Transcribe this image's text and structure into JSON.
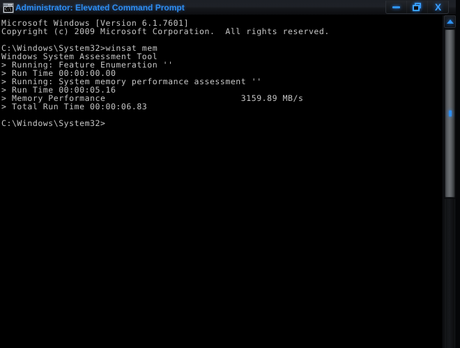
{
  "window": {
    "title": "Administrator: Elevated Command Prompt",
    "icon": "console-window-icon",
    "icon_text": "C:\\",
    "title_color": "#2f8ef0",
    "titlebar_background": "#15171b",
    "controls": [
      {
        "name": "minimize",
        "label": "Minimize",
        "glyph": "minimize-icon",
        "color": "#3094f2"
      },
      {
        "name": "restore",
        "label": "Restore Down",
        "glyph": "restore-icon",
        "color": "#3aa0ff"
      },
      {
        "name": "close",
        "label": "Close",
        "glyph": "X",
        "color": "#3aa0ff"
      }
    ]
  },
  "console": {
    "background_color": "#000000",
    "text_color": "#c6c6c6",
    "command": "winsat mem",
    "prompt": "C:\\Windows\\System32>",
    "lines": [
      "Microsoft Windows [Version 6.1.7601]",
      "Copyright (c) 2009 Microsoft Corporation.  All rights reserved.",
      "",
      "C:\\Windows\\System32>winsat mem",
      "Windows System Assessment Tool",
      "> Running: Feature Enumeration ''",
      "> Run Time 00:00:00.00",
      "> Running: System memory performance assessment ''",
      "> Run Time 00:00:05.16",
      "> Memory Performance                          3159.89 MB/s",
      "> Total Run Time 00:00:06.83",
      "",
      "C:\\Windows\\System32>"
    ],
    "results": {
      "tool_name": "Windows System Assessment Tool",
      "os_version": "Microsoft Windows [Version 6.1.7601]",
      "copyright": "Copyright (c) 2009 Microsoft Corporation.  All rights reserved.",
      "feature_enumeration_run_time": "00:00:00.00",
      "memory_assessment_run_time": "00:00:05.16",
      "memory_performance_label": "Memory Performance",
      "memory_performance_value": "3159.89 MB/s",
      "total_run_time": "00:00:06.83"
    }
  },
  "scrollbar": {
    "up_arrow": "scroll-up-arrow-icon",
    "thumb_grip": "scroll-thumb-grip",
    "accent_color": "#2f8ff2"
  }
}
